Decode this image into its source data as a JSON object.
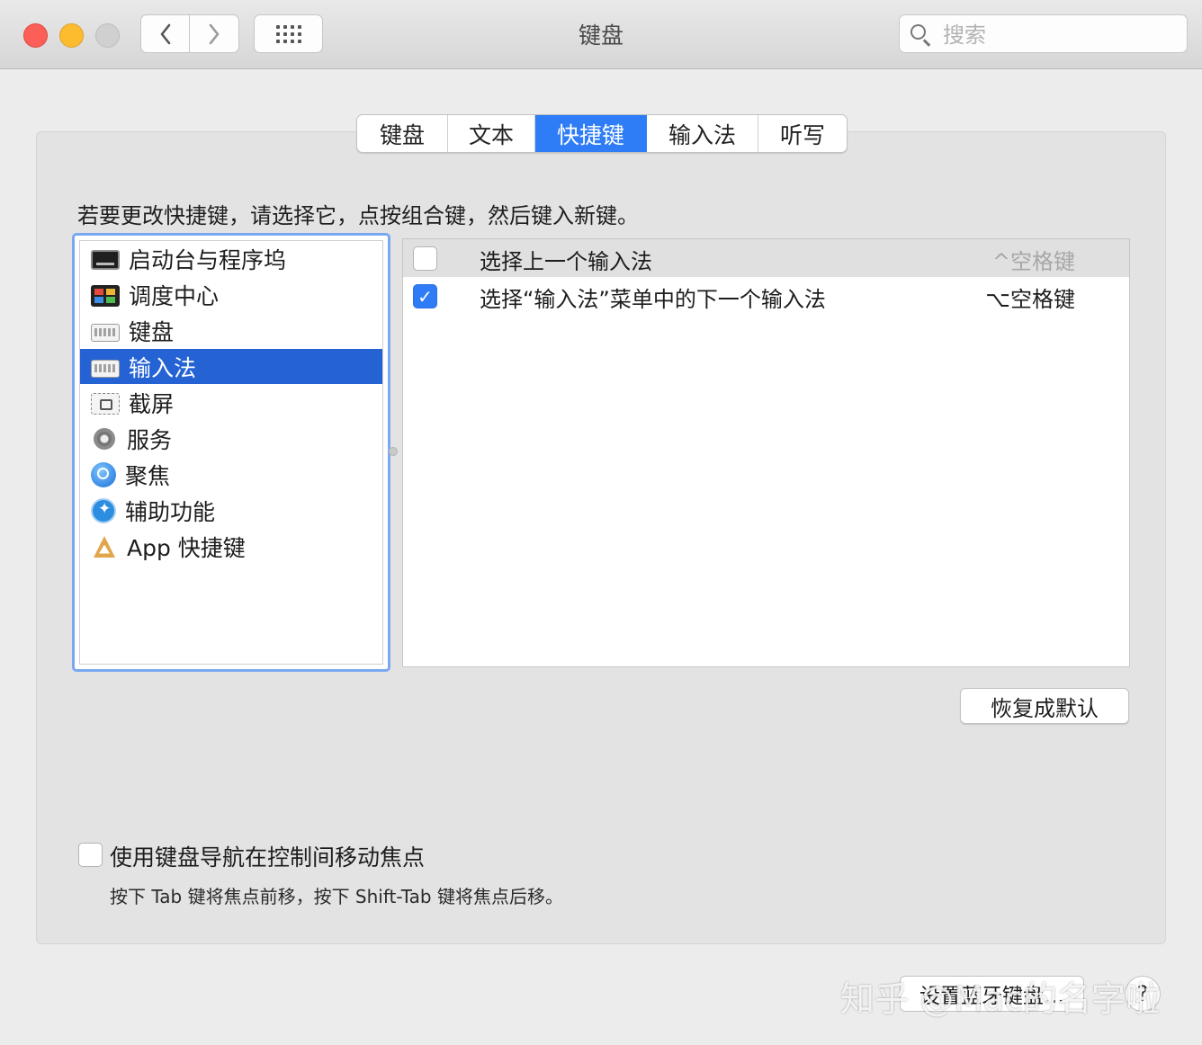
{
  "window": {
    "title": "键盘",
    "search_placeholder": "搜索",
    "nav": {
      "back_glyph": "‹",
      "forward_glyph": "›"
    }
  },
  "tabs": [
    {
      "label": "键盘",
      "active": false
    },
    {
      "label": "文本",
      "active": false
    },
    {
      "label": "快捷键",
      "active": true
    },
    {
      "label": "输入法",
      "active": false
    },
    {
      "label": "听写",
      "active": false
    }
  ],
  "instruction": "若要更改快捷键，请选择它，点按组合键，然后键入新键。",
  "categories": [
    {
      "label": "启动台与程序坞",
      "icon": "launchpad-icon",
      "selected": false
    },
    {
      "label": "调度中心",
      "icon": "mission-control-icon",
      "selected": false
    },
    {
      "label": "键盘",
      "icon": "keyboard-icon",
      "selected": false
    },
    {
      "label": "输入法",
      "icon": "keyboard-icon",
      "selected": true
    },
    {
      "label": "截屏",
      "icon": "screenshot-icon",
      "selected": false
    },
    {
      "label": "服务",
      "icon": "gear-icon",
      "selected": false
    },
    {
      "label": "聚焦",
      "icon": "spotlight-icon",
      "selected": false
    },
    {
      "label": "辅助功能",
      "icon": "accessibility-icon",
      "selected": false
    },
    {
      "label": "App 快捷键",
      "icon": "app-shortcuts-icon",
      "selected": false
    }
  ],
  "shortcuts": [
    {
      "label": "选择上一个输入法",
      "key": "^空格键",
      "checked": false
    },
    {
      "label": "选择“输入法”菜单中的下一个输入法",
      "key": "⌥空格键",
      "checked": true
    }
  ],
  "restore_button": "恢复成默认",
  "keyboard_nav": {
    "label": "使用键盘导航在控制间移动焦点",
    "checked": false,
    "hint": "按下 Tab 键将焦点前移，按下 Shift-Tab 键将焦点后移。"
  },
  "setup_button": "设置蓝牙键盘…",
  "help_button": "?",
  "watermark": "知乎 @Mac的名字啦",
  "colors": {
    "accent": "#2e7cf6",
    "selection": "#2563d5",
    "focus_ring": "#7aa8f0"
  }
}
